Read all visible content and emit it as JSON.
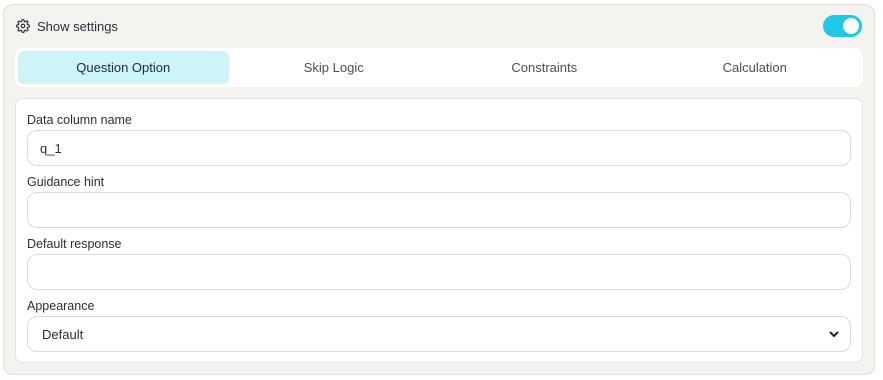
{
  "header": {
    "label": "Show settings",
    "icon": "gear-icon",
    "toggle_on": true,
    "toggle_color": "#1fc8e4"
  },
  "tabs": [
    {
      "label": "Question Option",
      "active": true
    },
    {
      "label": "Skip Logic",
      "active": false
    },
    {
      "label": "Constraints",
      "active": false
    },
    {
      "label": "Calculation",
      "active": false
    }
  ],
  "form": {
    "data_column_name": {
      "label": "Data column name",
      "value": "q_1"
    },
    "guidance_hint": {
      "label": "Guidance hint",
      "value": ""
    },
    "default_response": {
      "label": "Default response",
      "value": ""
    },
    "appearance": {
      "label": "Appearance",
      "value": "Default",
      "icon": "chevron-down-icon"
    }
  },
  "colors": {
    "accent": "#1fc8e4",
    "active_tab_bg": "#cdf4f9",
    "panel_bg": "#f5f3ef"
  }
}
